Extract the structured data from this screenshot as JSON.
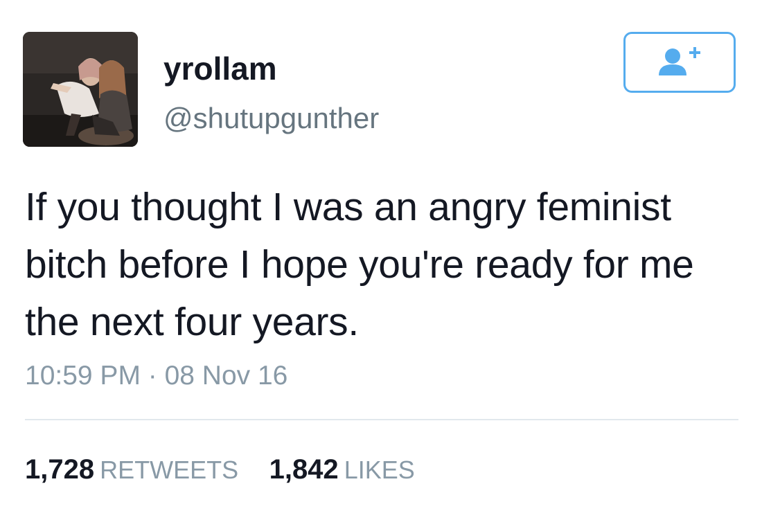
{
  "tweet": {
    "display_name": "yrollam",
    "handle": "@shutupgunther",
    "text_lines": [
      "If you thought I was an angry feminist",
      "bitch before I hope you're ready for me",
      "the next four years."
    ],
    "timestamp": "10:59 PM · 08 Nov 16",
    "retweets": {
      "count": "1,728",
      "label": "RETWEETS"
    },
    "likes": {
      "count": "1,842",
      "label": "LIKES"
    }
  },
  "follow_button": {
    "icon": "add-user-icon"
  },
  "colors": {
    "accent": "#55acee",
    "name": "#141823",
    "secondary": "#66757f",
    "muted": "#8899a6",
    "divider": "#e1e8ed"
  }
}
